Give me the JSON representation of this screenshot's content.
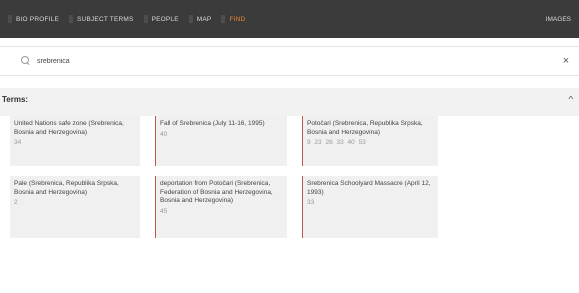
{
  "nav": {
    "items": [
      "BIO PROFILE",
      "SUBJECT TERMS",
      "PEOPLE",
      "MAP",
      "FIND"
    ],
    "active": "FIND",
    "right_label": "IMAGES"
  },
  "search": {
    "value": "srebrenica",
    "placeholder": "Search",
    "close_label": "×"
  },
  "terms": {
    "title": "Terms:",
    "collapse_label": "^",
    "cards": [
      {
        "label": "United Nations safe zone (Srebrenica, Bosnia and Herzegovina)",
        "count": "34"
      },
      {
        "label": "Fall of Srebrenica (July 11-16, 1995)",
        "count": "40"
      },
      {
        "label": "Potočari (Srebrenica, Republika Srpska, Bosnia and Herzegovina)",
        "count": "9  23  26  33  40  53"
      },
      {
        "label": "Pale (Srebrenica, Republika Srpska, Bosnia and Herzegovina)",
        "count": "2"
      },
      {
        "label": "deportation from Potočari (Srebrenica, Federation of Bosnia and Herzegovina, Bosnia and Herzegovina)",
        "count": "45"
      },
      {
        "label": "Srebrenica Schoolyard Massacre (April 12, 1993)",
        "count": "33"
      }
    ]
  },
  "colors": {
    "nav_bg": "#3b3b3b",
    "nav_active": "#e8872f",
    "accent_border": "#c0564a"
  }
}
